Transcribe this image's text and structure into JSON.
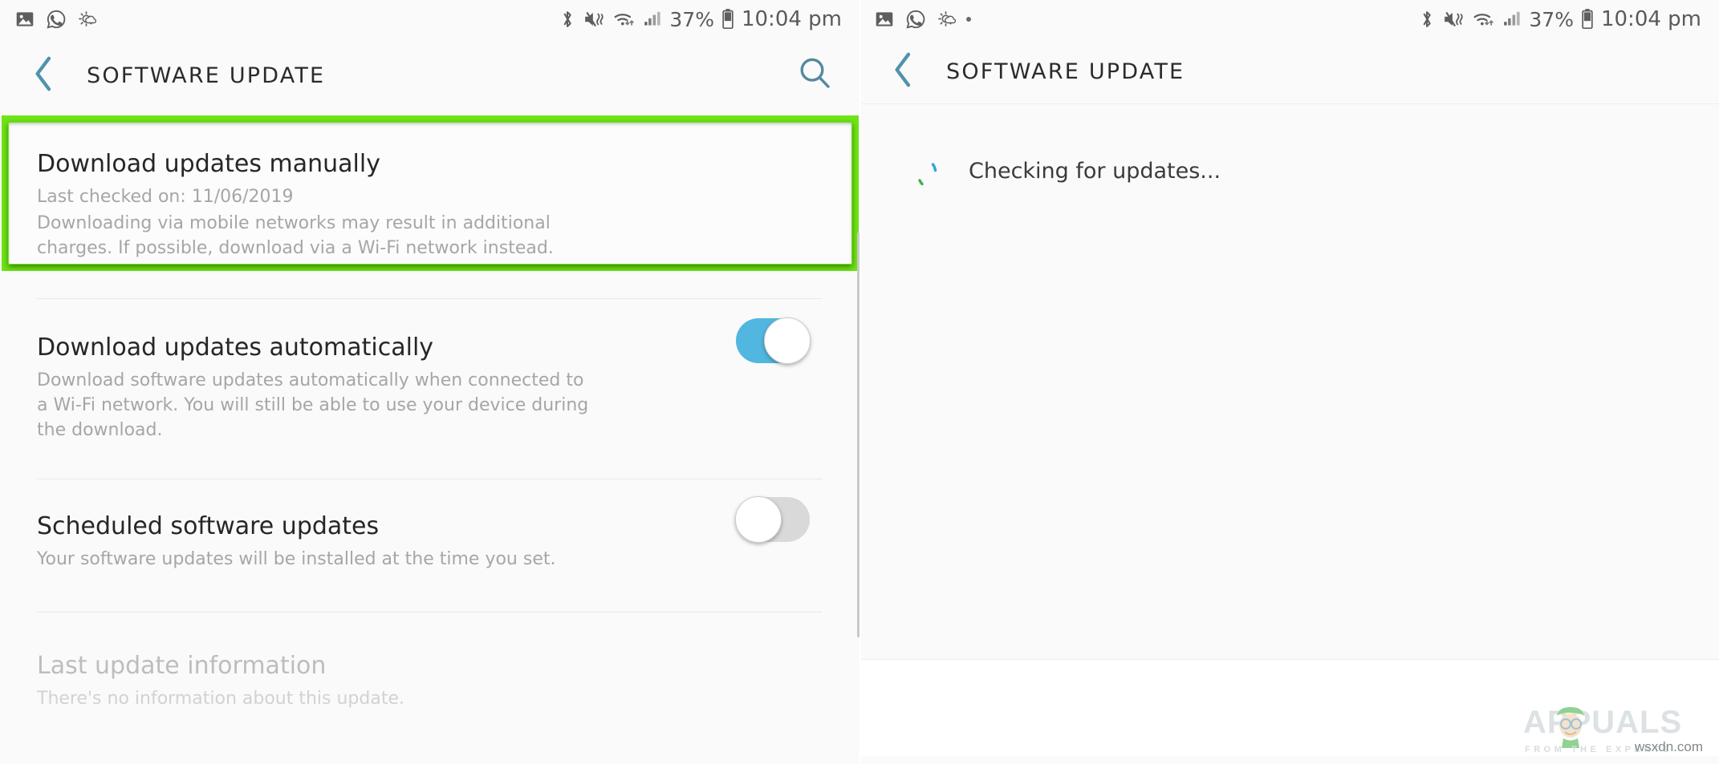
{
  "left": {
    "statusbar": {
      "icons_left": [
        "image-icon",
        "whatsapp-icon",
        "weather-icon"
      ],
      "icons_right": [
        "bluetooth-icon",
        "mute-vibrate-icon",
        "wifi-icon",
        "signal-icon"
      ],
      "battery_percent": "37%",
      "battery_icon": "battery-icon",
      "time": "10:04 pm"
    },
    "appbar": {
      "back_icon": "back-chevron-icon",
      "title": "SOFTWARE UPDATE",
      "search_icon": "search-icon"
    },
    "rows": [
      {
        "title": "Download updates manually",
        "sub_line1": "Last checked on: 11/06/2019",
        "sub_line2": "Downloading via mobile networks may result in additional charges. If possible, download via a Wi-Fi network instead."
      },
      {
        "title": "Download updates automatically",
        "sub": "Download software updates automatically when connected to a Wi-Fi network. You will still be able to use your device during the download.",
        "toggle_state": "on"
      },
      {
        "title": "Scheduled software updates",
        "sub": "Your software updates will be installed at the time you set.",
        "toggle_state": "off"
      },
      {
        "title": "Last update information",
        "sub": "There's no information about this update."
      }
    ],
    "highlight_color": "#6ee515"
  },
  "right": {
    "statusbar": {
      "icons_left": [
        "image-icon",
        "whatsapp-icon",
        "weather-icon",
        "notification-dot"
      ],
      "icons_right": [
        "bluetooth-icon",
        "mute-vibrate-icon",
        "wifi-icon",
        "signal-icon"
      ],
      "battery_percent": "37%",
      "battery_icon": "battery-icon",
      "time": "10:04 pm"
    },
    "appbar": {
      "back_icon": "back-chevron-icon",
      "title": "SOFTWARE UPDATE"
    },
    "status": {
      "spinner_icon": "loading-spinner-icon",
      "spinner_colors": [
        "#3bb24a",
        "#2ea7d6"
      ],
      "text": "Checking for updates..."
    }
  },
  "watermark": {
    "brand": "APPUALS",
    "tagline": "FROM THE EXPERTS",
    "site": "wsxdn.com"
  },
  "colors": {
    "accent_teal": "#4f93ab",
    "toggle_on": "#51b6e0",
    "toggle_off": "#d9d9d9",
    "highlight_green": "#6ee515",
    "background": "#fafafa"
  }
}
